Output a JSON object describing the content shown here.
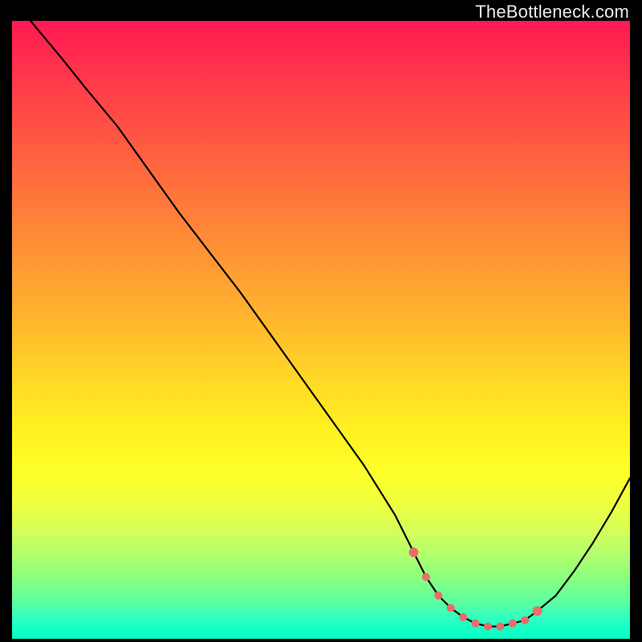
{
  "site_credit": "TheBottleneck.com",
  "colors": {
    "curve": "#000000",
    "marker": "#ec6b6b",
    "bg_black": "#000000"
  },
  "chart_data": {
    "type": "line",
    "title": "",
    "xlabel": "",
    "ylabel": "",
    "xlim": [
      0,
      100
    ],
    "ylim": [
      0,
      100
    ],
    "x": [
      3,
      8,
      12,
      17,
      22,
      27,
      32,
      37,
      42,
      47,
      52,
      57,
      62,
      65,
      67,
      69,
      71,
      73,
      75,
      77,
      79,
      81,
      83,
      85,
      88,
      91,
      94,
      97,
      100
    ],
    "values": [
      100,
      94,
      89,
      83,
      76,
      69,
      62.5,
      56,
      49,
      42,
      35,
      28,
      20,
      14,
      10,
      7,
      5,
      3.5,
      2.5,
      2,
      2,
      2.5,
      3,
      4.5,
      7,
      11,
      15.5,
      20.5,
      26
    ],
    "markers_x": [
      65,
      67,
      69,
      71,
      73,
      75,
      77,
      79,
      81,
      83,
      85
    ],
    "markers_y": [
      14,
      10,
      7,
      5,
      3.5,
      2.5,
      2,
      2,
      2.5,
      3,
      4.5
    ],
    "annotations": []
  }
}
